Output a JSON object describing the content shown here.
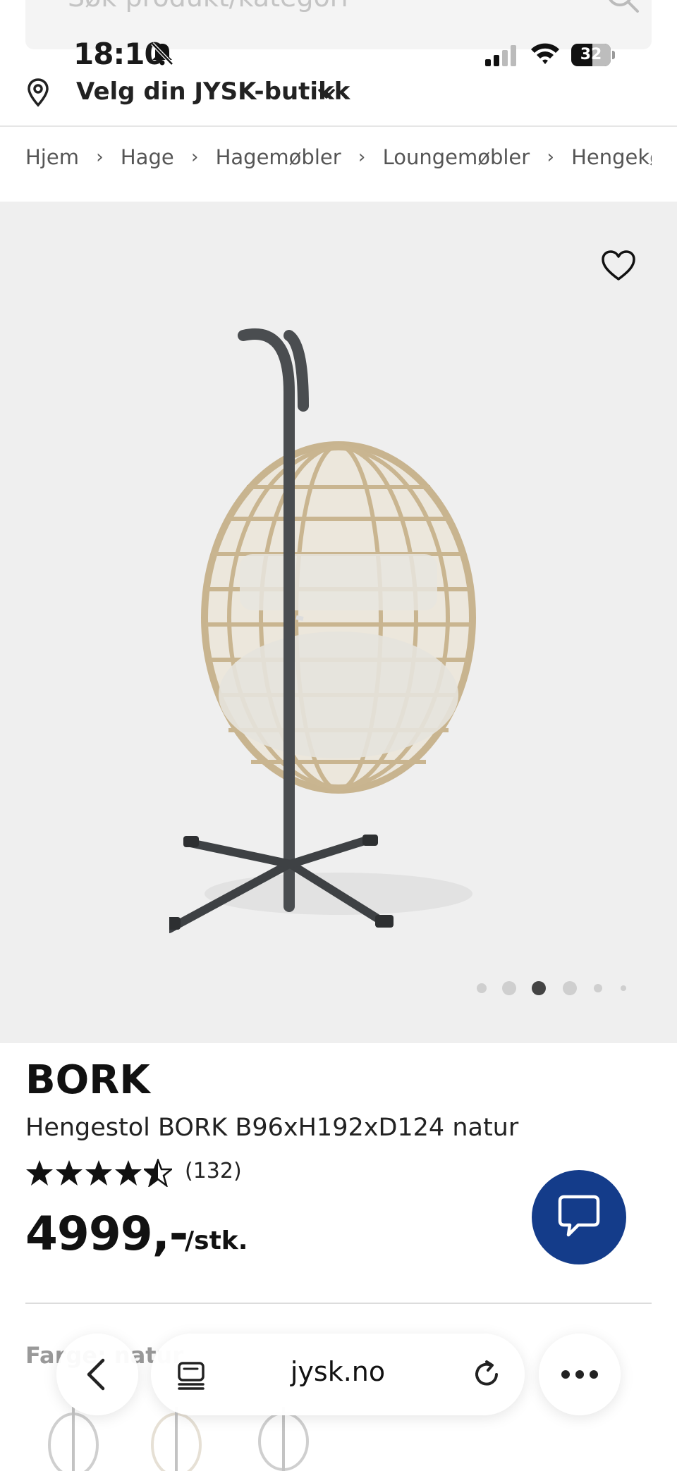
{
  "search": {
    "placeholder": "Søk produkt/kategori",
    "icon": "search-icon"
  },
  "status_bar": {
    "time": "18:10",
    "battery": "32"
  },
  "store": {
    "label": "Velg din JYSK-butikk"
  },
  "breadcrumb": [
    "Hjem",
    "Hage",
    "Hagemøbler",
    "Loungemøbler",
    "Hengekøyer og hengestoler"
  ],
  "gallery": {
    "active_index": 2,
    "dot_count": 6
  },
  "product": {
    "brand": "BORK",
    "name": "Hengestol BORK B96xH192xD124 natur",
    "rating": 4.5,
    "rating_max": 5,
    "reviews": "(132)",
    "price": "4999,-",
    "unit": "/stk."
  },
  "color_section": {
    "label": "Farge: natur"
  },
  "browser": {
    "url": "jysk.no"
  },
  "colors": {
    "brand_blue": "#143c8a",
    "gallery_bg": "#efefef"
  }
}
